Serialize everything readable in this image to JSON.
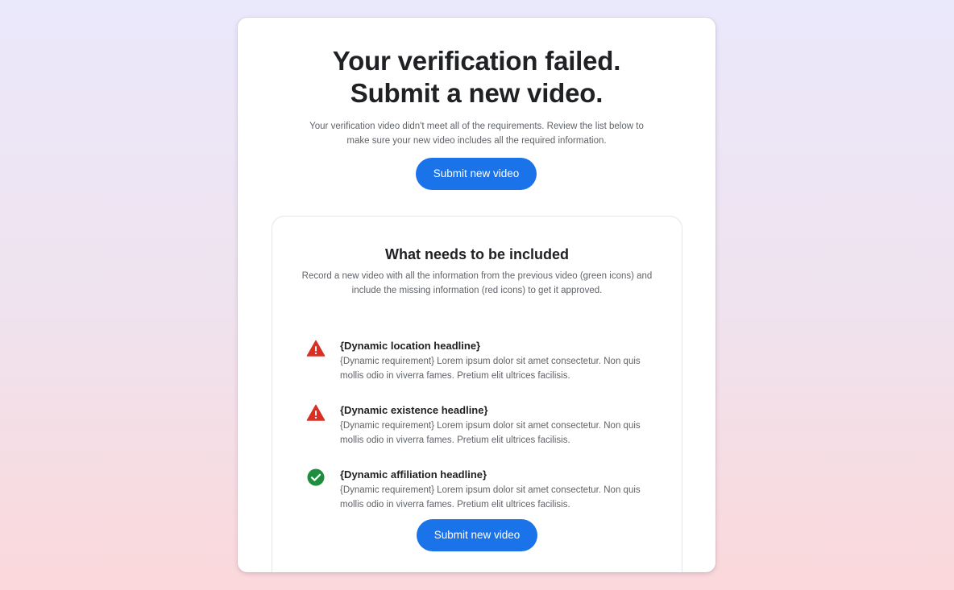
{
  "header": {
    "title_line1": "Your verification failed.",
    "title_line2": "Submit a new video.",
    "description": "Your verification video didn't meet all of the requirements. Review the list below to make sure your new video includes all the required information."
  },
  "primary_button_label": "Submit new video",
  "requirements_section": {
    "title": "What needs to be included",
    "description": "Record a new video with all the information from the previous video (green icons) and include the missing information (red icons) to get it approved.",
    "items": [
      {
        "status": "missing",
        "icon": "warning-icon",
        "headline": "{Dynamic location headline}",
        "body": "{Dynamic requirement} Lorem ipsum dolor sit amet consectetur. Non quis mollis odio in viverra fames. Pretium elit ultrices facilisis."
      },
      {
        "status": "missing",
        "icon": "warning-icon",
        "headline": "{Dynamic existence headline}",
        "body": "{Dynamic requirement} Lorem ipsum dolor sit amet consectetur. Non quis mollis odio in viverra fames. Pretium elit ultrices facilisis."
      },
      {
        "status": "met",
        "icon": "check-circle-icon",
        "headline": "{Dynamic affiliation headline}",
        "body": "{Dynamic requirement} Lorem ipsum dolor sit amet consectetur. Non quis mollis odio in viverra fames. Pretium elit ultrices facilisis."
      }
    ],
    "bottom_button_label": "Submit new video"
  },
  "colors": {
    "accent": "#1a73e8",
    "error": "#d93025",
    "success": "#1e8e3e",
    "text_primary": "#202124",
    "text_secondary": "#5f6368"
  }
}
